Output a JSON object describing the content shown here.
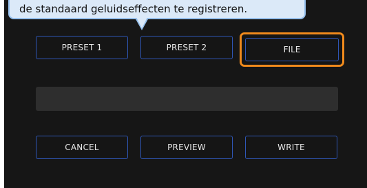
{
  "tooltip": {
    "text": "de standaard geluidseffecten te registreren."
  },
  "presets": {
    "preset1_label": "PRESET 1",
    "preset2_label": "PRESET 2",
    "file_label": "FILE"
  },
  "filename_field": {
    "value": ""
  },
  "actions": {
    "cancel_label": "CANCEL",
    "preview_label": "PREVIEW",
    "write_label": "WRITE"
  },
  "colors": {
    "panel_bg": "#161616",
    "button_border": "#2f57b8",
    "highlight": "#f08a1c",
    "tooltip_bg": "#dbe9f8",
    "tooltip_border": "#97c1ee",
    "field_bg": "#2e2e2e"
  }
}
